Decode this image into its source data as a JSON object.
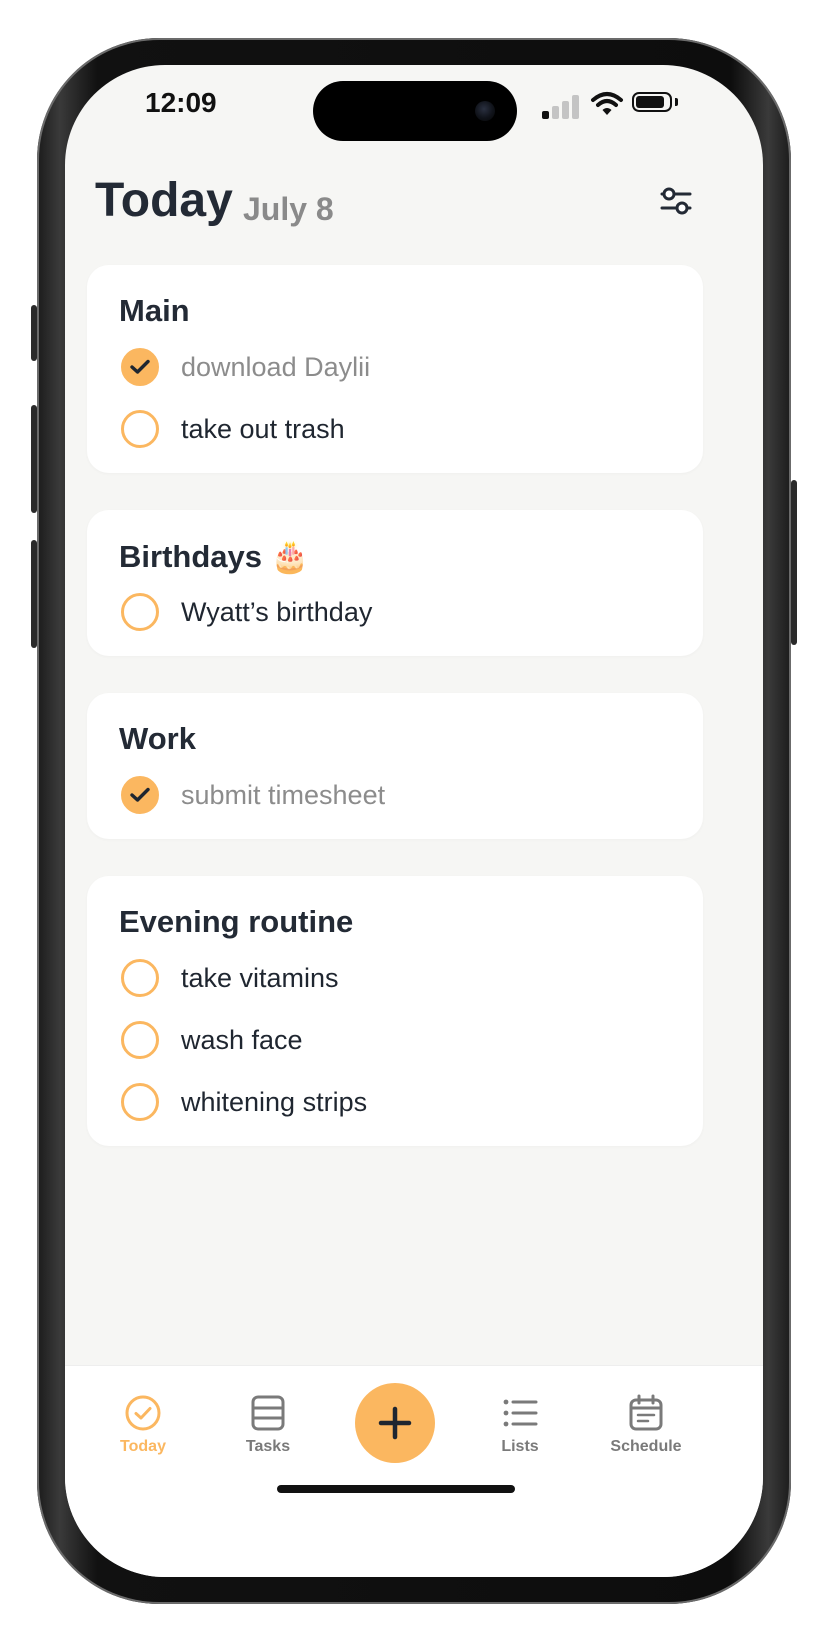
{
  "status_bar": {
    "time": "12:09"
  },
  "header": {
    "title": "Today",
    "date": "July 8"
  },
  "cards": [
    {
      "title": "Main",
      "tasks": [
        {
          "label": "download Daylii",
          "done": true
        },
        {
          "label": "take out trash",
          "done": false
        }
      ]
    },
    {
      "title": "Birthdays 🎂",
      "tasks": [
        {
          "label": "Wyatt’s birthday",
          "done": false
        }
      ]
    },
    {
      "title": "Work",
      "tasks": [
        {
          "label": "submit timesheet",
          "done": true
        }
      ]
    },
    {
      "title": "Evening routine",
      "tasks": [
        {
          "label": "take vitamins",
          "done": false
        },
        {
          "label": "wash face",
          "done": false
        },
        {
          "label": "whitening strips",
          "done": false
        }
      ]
    }
  ],
  "tabbar": {
    "items": [
      {
        "label": "Today",
        "icon": "check-circle-icon",
        "active": true
      },
      {
        "label": "Tasks",
        "icon": "tasks-icon",
        "active": false
      },
      {
        "label": "Lists",
        "icon": "list-icon",
        "active": false
      },
      {
        "label": "Schedule",
        "icon": "calendar-icon",
        "active": false
      }
    ],
    "add_icon": "plus-icon"
  },
  "colors": {
    "accent": "#fbb760",
    "title_text": "#232a35",
    "muted_text": "#8c8c8c",
    "screen_bg": "#f6f6f4",
    "card_bg": "#ffffff"
  }
}
